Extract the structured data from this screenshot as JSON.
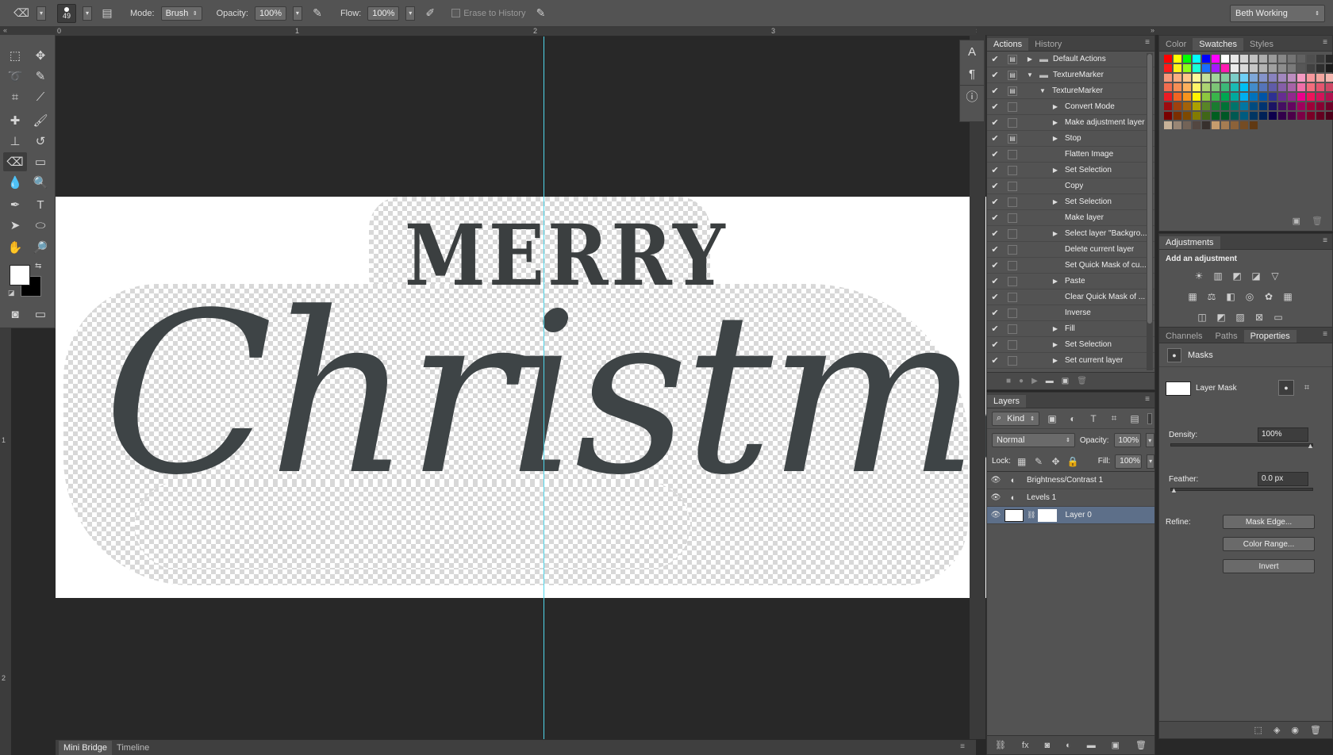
{
  "options": {
    "brush_size": "49",
    "mode_label": "Mode:",
    "mode_value": "Brush",
    "opacity_label": "Opacity:",
    "opacity_value": "100%",
    "flow_label": "Flow:",
    "flow_value": "100%",
    "erase_history_label": "Erase to History",
    "workspace": "Beth Working"
  },
  "ruler": {
    "top": [
      "0",
      "1",
      "2",
      "3"
    ],
    "left": [
      "1",
      "2"
    ]
  },
  "artwork": {
    "line1": "MERRY",
    "line2": "Christmas"
  },
  "bottom_tabs": [
    "Mini Bridge",
    "Timeline"
  ],
  "actions_panel": {
    "tabs": [
      "Actions",
      "History"
    ],
    "rows": [
      {
        "label": "Default Actions",
        "indent": 0,
        "expand": "right",
        "folder": true
      },
      {
        "label": "TextureMarker",
        "indent": 0,
        "expand": "down",
        "folder": true
      },
      {
        "label": "TextureMarker",
        "indent": 1,
        "expand": "down"
      },
      {
        "label": "Convert Mode",
        "indent": 2,
        "expand": "right"
      },
      {
        "label": "Make adjustment layer",
        "indent": 2,
        "expand": "right"
      },
      {
        "label": "Stop",
        "indent": 2,
        "expand": "right",
        "dialog": true
      },
      {
        "label": "Flatten Image",
        "indent": 2,
        "expand": ""
      },
      {
        "label": "Set Selection",
        "indent": 2,
        "expand": "right"
      },
      {
        "label": "Copy",
        "indent": 2,
        "expand": ""
      },
      {
        "label": "Set Selection",
        "indent": 2,
        "expand": "right"
      },
      {
        "label": "Make layer",
        "indent": 2,
        "expand": ""
      },
      {
        "label": "Select layer \"Backgro...",
        "indent": 2,
        "expand": "right"
      },
      {
        "label": "Delete current layer",
        "indent": 2,
        "expand": ""
      },
      {
        "label": "Set Quick Mask of cu...",
        "indent": 2,
        "expand": ""
      },
      {
        "label": "Paste",
        "indent": 2,
        "expand": "right"
      },
      {
        "label": "Clear Quick Mask of ...",
        "indent": 2,
        "expand": ""
      },
      {
        "label": "Inverse",
        "indent": 2,
        "expand": ""
      },
      {
        "label": "Fill",
        "indent": 2,
        "expand": "right"
      },
      {
        "label": "Set Selection",
        "indent": 2,
        "expand": "right"
      },
      {
        "label": "Set current layer",
        "indent": 2,
        "expand": "right"
      }
    ]
  },
  "swatches_panel": {
    "tabs": [
      "Color",
      "Swatches",
      "Styles"
    ],
    "colors": [
      "#ff0000",
      "#ffff00",
      "#00ff00",
      "#00ffff",
      "#0000ff",
      "#ff00ff",
      "#ffffff",
      "#e6e6e6",
      "#d3d3d3",
      "#c0c0c0",
      "#adadad",
      "#9a9a9a",
      "#878787",
      "#747474",
      "#616161",
      "#4e4e4e",
      "#3b3b3b",
      "#282828",
      "#151515",
      "#ff1a1a",
      "#fff21a",
      "#8cff1a",
      "#1affd9",
      "#1a6cff",
      "#a51aff",
      "#ff1ab2",
      "#ececec",
      "#d9d9d9",
      "#c6c6c6",
      "#b3b3b3",
      "#a0a0a0",
      "#8d8d8d",
      "#7a7a7a",
      "#575757",
      "#414141",
      "#2e2e2e",
      "#1b1b1b",
      "#000000",
      "#f7977a",
      "#f9ad81",
      "#fdc68a",
      "#fff79a",
      "#c4df9b",
      "#a2d39c",
      "#82ca9d",
      "#7bcdc8",
      "#6ecff6",
      "#7ea7d8",
      "#8493ca",
      "#8882be",
      "#a187be",
      "#bc8dbf",
      "#f49ac2",
      "#f6989d",
      "#f3a6a0",
      "#f5b7b0",
      "#e89ba6",
      "#f26c4f",
      "#f68e55",
      "#fbaf5c",
      "#fff467",
      "#acd372",
      "#7cc576",
      "#3bb878",
      "#1abbb4",
      "#00bff3",
      "#438cca",
      "#5574b9",
      "#605ca8",
      "#855fa8",
      "#a763a8",
      "#f06ea9",
      "#f26d7d",
      "#e4556f",
      "#cf4866",
      "#b63b5b",
      "#ed1c24",
      "#f26522",
      "#f7941d",
      "#fff200",
      "#8dc73f",
      "#39b54a",
      "#00a651",
      "#00a99d",
      "#00aeef",
      "#0072bc",
      "#0054a6",
      "#2e3192",
      "#662d91",
      "#92278f",
      "#ec008c",
      "#ed145b",
      "#d2145a",
      "#b0124f",
      "#8e0f42",
      "#9e0b0f",
      "#a0410d",
      "#a36209",
      "#aba000",
      "#598527",
      "#1a7b30",
      "#007236",
      "#00746b",
      "#0076a3",
      "#004b80",
      "#003471",
      "#1b1464",
      "#440e62",
      "#630460",
      "#9e005d",
      "#9e0039",
      "#870032",
      "#6f0029",
      "#560020",
      "#790000",
      "#7b2e00",
      "#7d4900",
      "#827b00",
      "#406618",
      "#005e20",
      "#005826",
      "#005952",
      "#005b7f",
      "#003663",
      "#002157",
      "#0d004c",
      "#32004b",
      "#4b0049",
      "#7b0046",
      "#7a0026",
      "#640020",
      "#4e001a",
      "#380013",
      "#c7b299",
      "#998675",
      "#736357",
      "#534741",
      "#37302d",
      "#c69c6d",
      "#a67c52",
      "#8c6239",
      "#754c24",
      "#603913"
    ]
  },
  "adjustments_panel": {
    "title": "Adjustments",
    "subtitle": "Add an adjustment"
  },
  "properties_panel": {
    "tabs": [
      "Channels",
      "Paths",
      "Properties"
    ],
    "section": "Masks",
    "mask_label": "Layer Mask",
    "density_label": "Density:",
    "density_value": "100%",
    "density_level": 1.0,
    "feather_label": "Feather:",
    "feather_value": "0.0 px",
    "feather_level": 0.0,
    "refine_label": "Refine:",
    "mask_edge_button": "Mask Edge...",
    "color_range_button": "Color Range...",
    "invert_button": "Invert"
  },
  "layers_panel": {
    "title": "Layers",
    "kind_label": "Kind",
    "blend_mode": "Normal",
    "opacity_label": "Opacity:",
    "opacity_value": "100%",
    "lock_label": "Lock:",
    "fill_label": "Fill:",
    "fill_value": "100%",
    "layers": [
      {
        "name": "Brightness/Contrast 1",
        "type": "adjustment",
        "selected": false
      },
      {
        "name": "Levels 1",
        "type": "adjustment",
        "selected": false
      },
      {
        "name": "Layer 0",
        "type": "pixel-with-mask",
        "selected": true
      }
    ]
  }
}
